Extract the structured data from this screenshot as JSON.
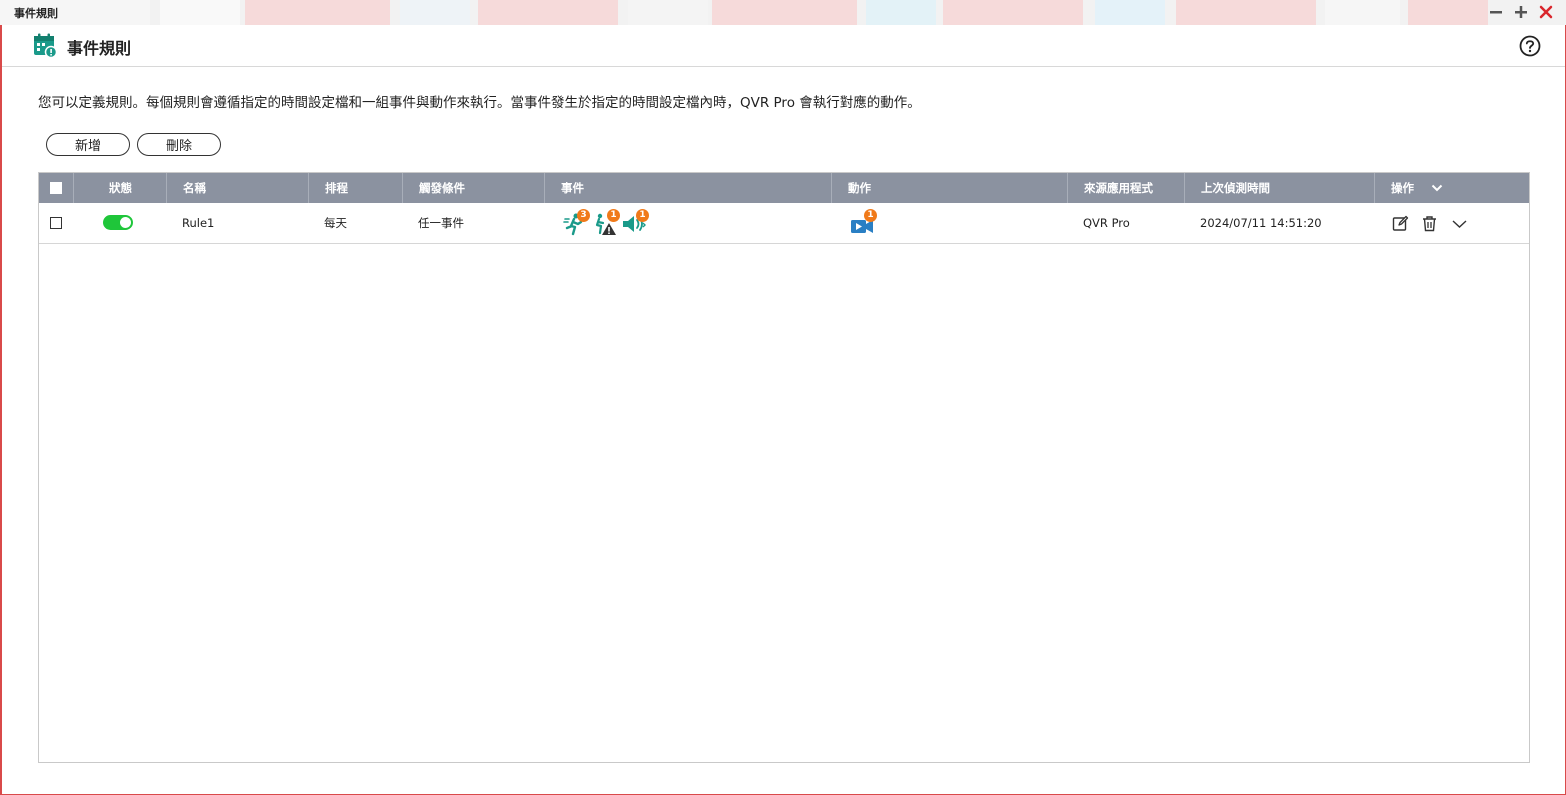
{
  "window": {
    "title": "事件規則",
    "colors": {
      "frame": "#d94a4a",
      "close": "#d9262c"
    },
    "controls": [
      "minimize-icon",
      "maximize-icon",
      "close-icon"
    ]
  },
  "header": {
    "title": "事件規則",
    "app_icon": "calendar-event-icon",
    "help_icon": "help-icon"
  },
  "description": "您可以定義規則。每個規則會遵循指定的時間設定檔和一組事件與動作來執行。當事件發生於指定的時間設定檔內時，QVR Pro 會執行對應的動作。",
  "toolbar": {
    "add_label": "新增",
    "delete_label": "刪除"
  },
  "table": {
    "columns": {
      "status": "狀態",
      "name": "名稱",
      "schedule": "排程",
      "trigger": "觸發條件",
      "event": "事件",
      "action": "動作",
      "source": "來源應用程式",
      "last_detected": "上次偵測時間",
      "operation": "操作"
    },
    "header_colors": {
      "background": "#8b92a0",
      "toggle_on": "#1fc63a",
      "badge": "#f07a1a",
      "icon": "#1a9a8a",
      "action_icon": "#2a7fc4"
    },
    "rows": [
      {
        "checked": false,
        "status_on": true,
        "name": "Rule1",
        "schedule": "每天",
        "trigger": "任一事件",
        "events": [
          {
            "icon": "motion-detection-icon",
            "count": "3"
          },
          {
            "icon": "alarm-alert-icon",
            "count": "1"
          },
          {
            "icon": "audio-detection-icon",
            "count": "1"
          }
        ],
        "actions": [
          {
            "icon": "recording-icon",
            "count": "1"
          }
        ],
        "source": "QVR Pro",
        "last_detected": "2024/07/11 14:51:20",
        "operations": [
          "edit-icon",
          "delete-icon",
          "chevron-down-icon"
        ]
      }
    ]
  }
}
